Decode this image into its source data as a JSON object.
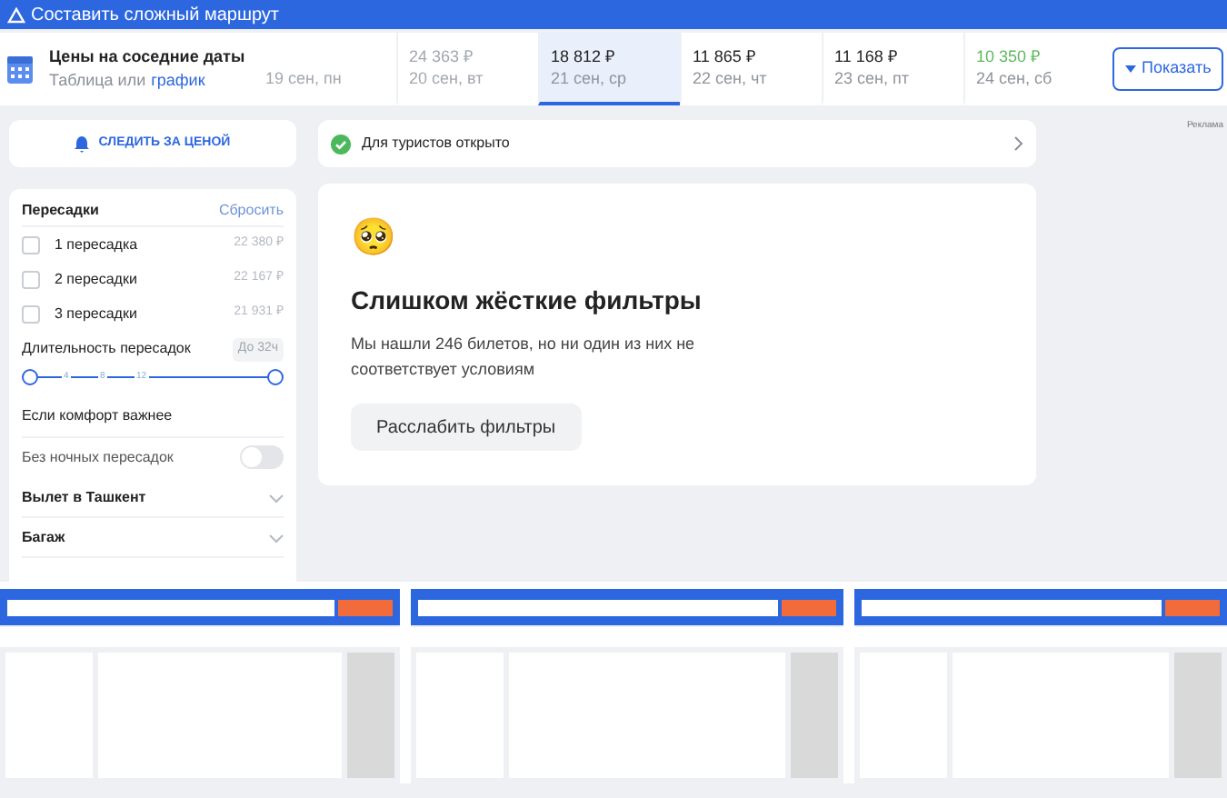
{
  "top_bar": {
    "link": "Составить сложный маршрут"
  },
  "dates": {
    "title": "Цены на соседние даты",
    "subtitle": "Таблица или",
    "subtitle_link": "график",
    "items": [
      {
        "date": "19 сен, пн",
        "selected": false,
        "kind": "faded"
      },
      {
        "price": "24 363 ₽",
        "date": "20 сен, вт",
        "selected": false,
        "kind": "faded"
      },
      {
        "price": "18 812 ₽",
        "date": "21 сен, ср",
        "selected": true,
        "kind": "normal"
      },
      {
        "price": "11 865 ₽",
        "date": "22 сен, чт",
        "selected": false,
        "kind": "normal"
      },
      {
        "price": "11 168 ₽",
        "date": "23 сен, пт",
        "selected": false,
        "kind": "normal"
      },
      {
        "price": "10 350 ₽",
        "date": "24 сен, сб",
        "selected": false,
        "kind": "cheapest"
      }
    ],
    "show_button": "Показать"
  },
  "track_button": "СЛЕДИТЬ ЗА ЦЕНОЙ",
  "notice": "Для туристов открыто",
  "filters": {
    "title": "Пересадки",
    "reset": "Сбросить",
    "stops": [
      {
        "label": "1 пересадка",
        "price": "22 380 ₽",
        "checked": false
      },
      {
        "label": "2 пересадки",
        "price": "22 167 ₽",
        "checked": false
      },
      {
        "label": "3 пересадки",
        "price": "21 931 ₽",
        "checked": false
      }
    ],
    "duration_label": "Длительность пересадок",
    "duration_value": "До 32ч",
    "duration_ticks": [
      "4",
      "8",
      "12"
    ],
    "duration_slider": {
      "level": 1
    },
    "comfort_title": "Если комфорт важнее",
    "night_label": "Без ночных пересадок",
    "night_on": false,
    "sections": [
      "Вылет в Ташкент",
      "Багаж"
    ]
  },
  "empty_state": {
    "emoji": "🥺",
    "title": "Слишком жёсткие фильтры",
    "text": "Мы нашли 246 билетов, но ни один из них не соответствует условиям",
    "button": "Расслабить фильтры"
  },
  "ad_label": "Реклама"
}
